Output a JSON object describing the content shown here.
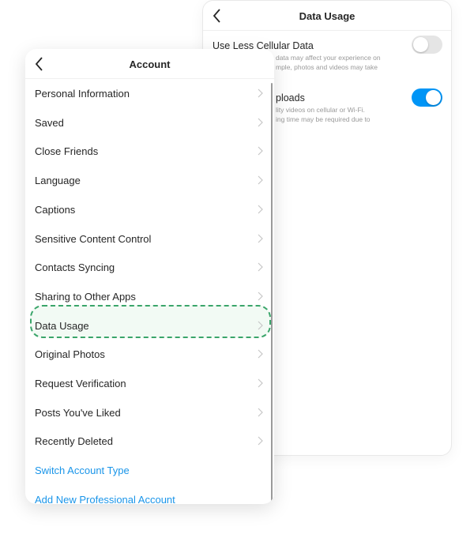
{
  "data_usage": {
    "title": "Data Usage",
    "options": [
      {
        "title": "Use Less Cellular Data",
        "desc1": "data may affect your experience on",
        "desc2": "mple, photos and videos may take",
        "enabled": false
      },
      {
        "title": "ploads",
        "desc1": "lity videos on cellular or Wi-Fi.",
        "desc2": "ing time may be required due to",
        "enabled": true
      }
    ]
  },
  "account": {
    "title": "Account",
    "items": [
      {
        "label": "Personal Information"
      },
      {
        "label": "Saved"
      },
      {
        "label": "Close Friends"
      },
      {
        "label": "Language"
      },
      {
        "label": "Captions"
      },
      {
        "label": "Sensitive Content Control"
      },
      {
        "label": "Contacts Syncing"
      },
      {
        "label": "Sharing to Other Apps"
      },
      {
        "label": "Data Usage",
        "highlighted": true
      },
      {
        "label": "Original Photos"
      },
      {
        "label": "Request Verification"
      },
      {
        "label": "Posts You've Liked"
      },
      {
        "label": "Recently Deleted"
      },
      {
        "label": "Switch Account Type",
        "link": true
      },
      {
        "label": "Add New Professional Account",
        "link": true
      }
    ]
  },
  "colors": {
    "accent": "#0095f6",
    "link": "#1a95e9",
    "highlight": "#3aa56a",
    "toggle_off": "#e5e5e5"
  }
}
